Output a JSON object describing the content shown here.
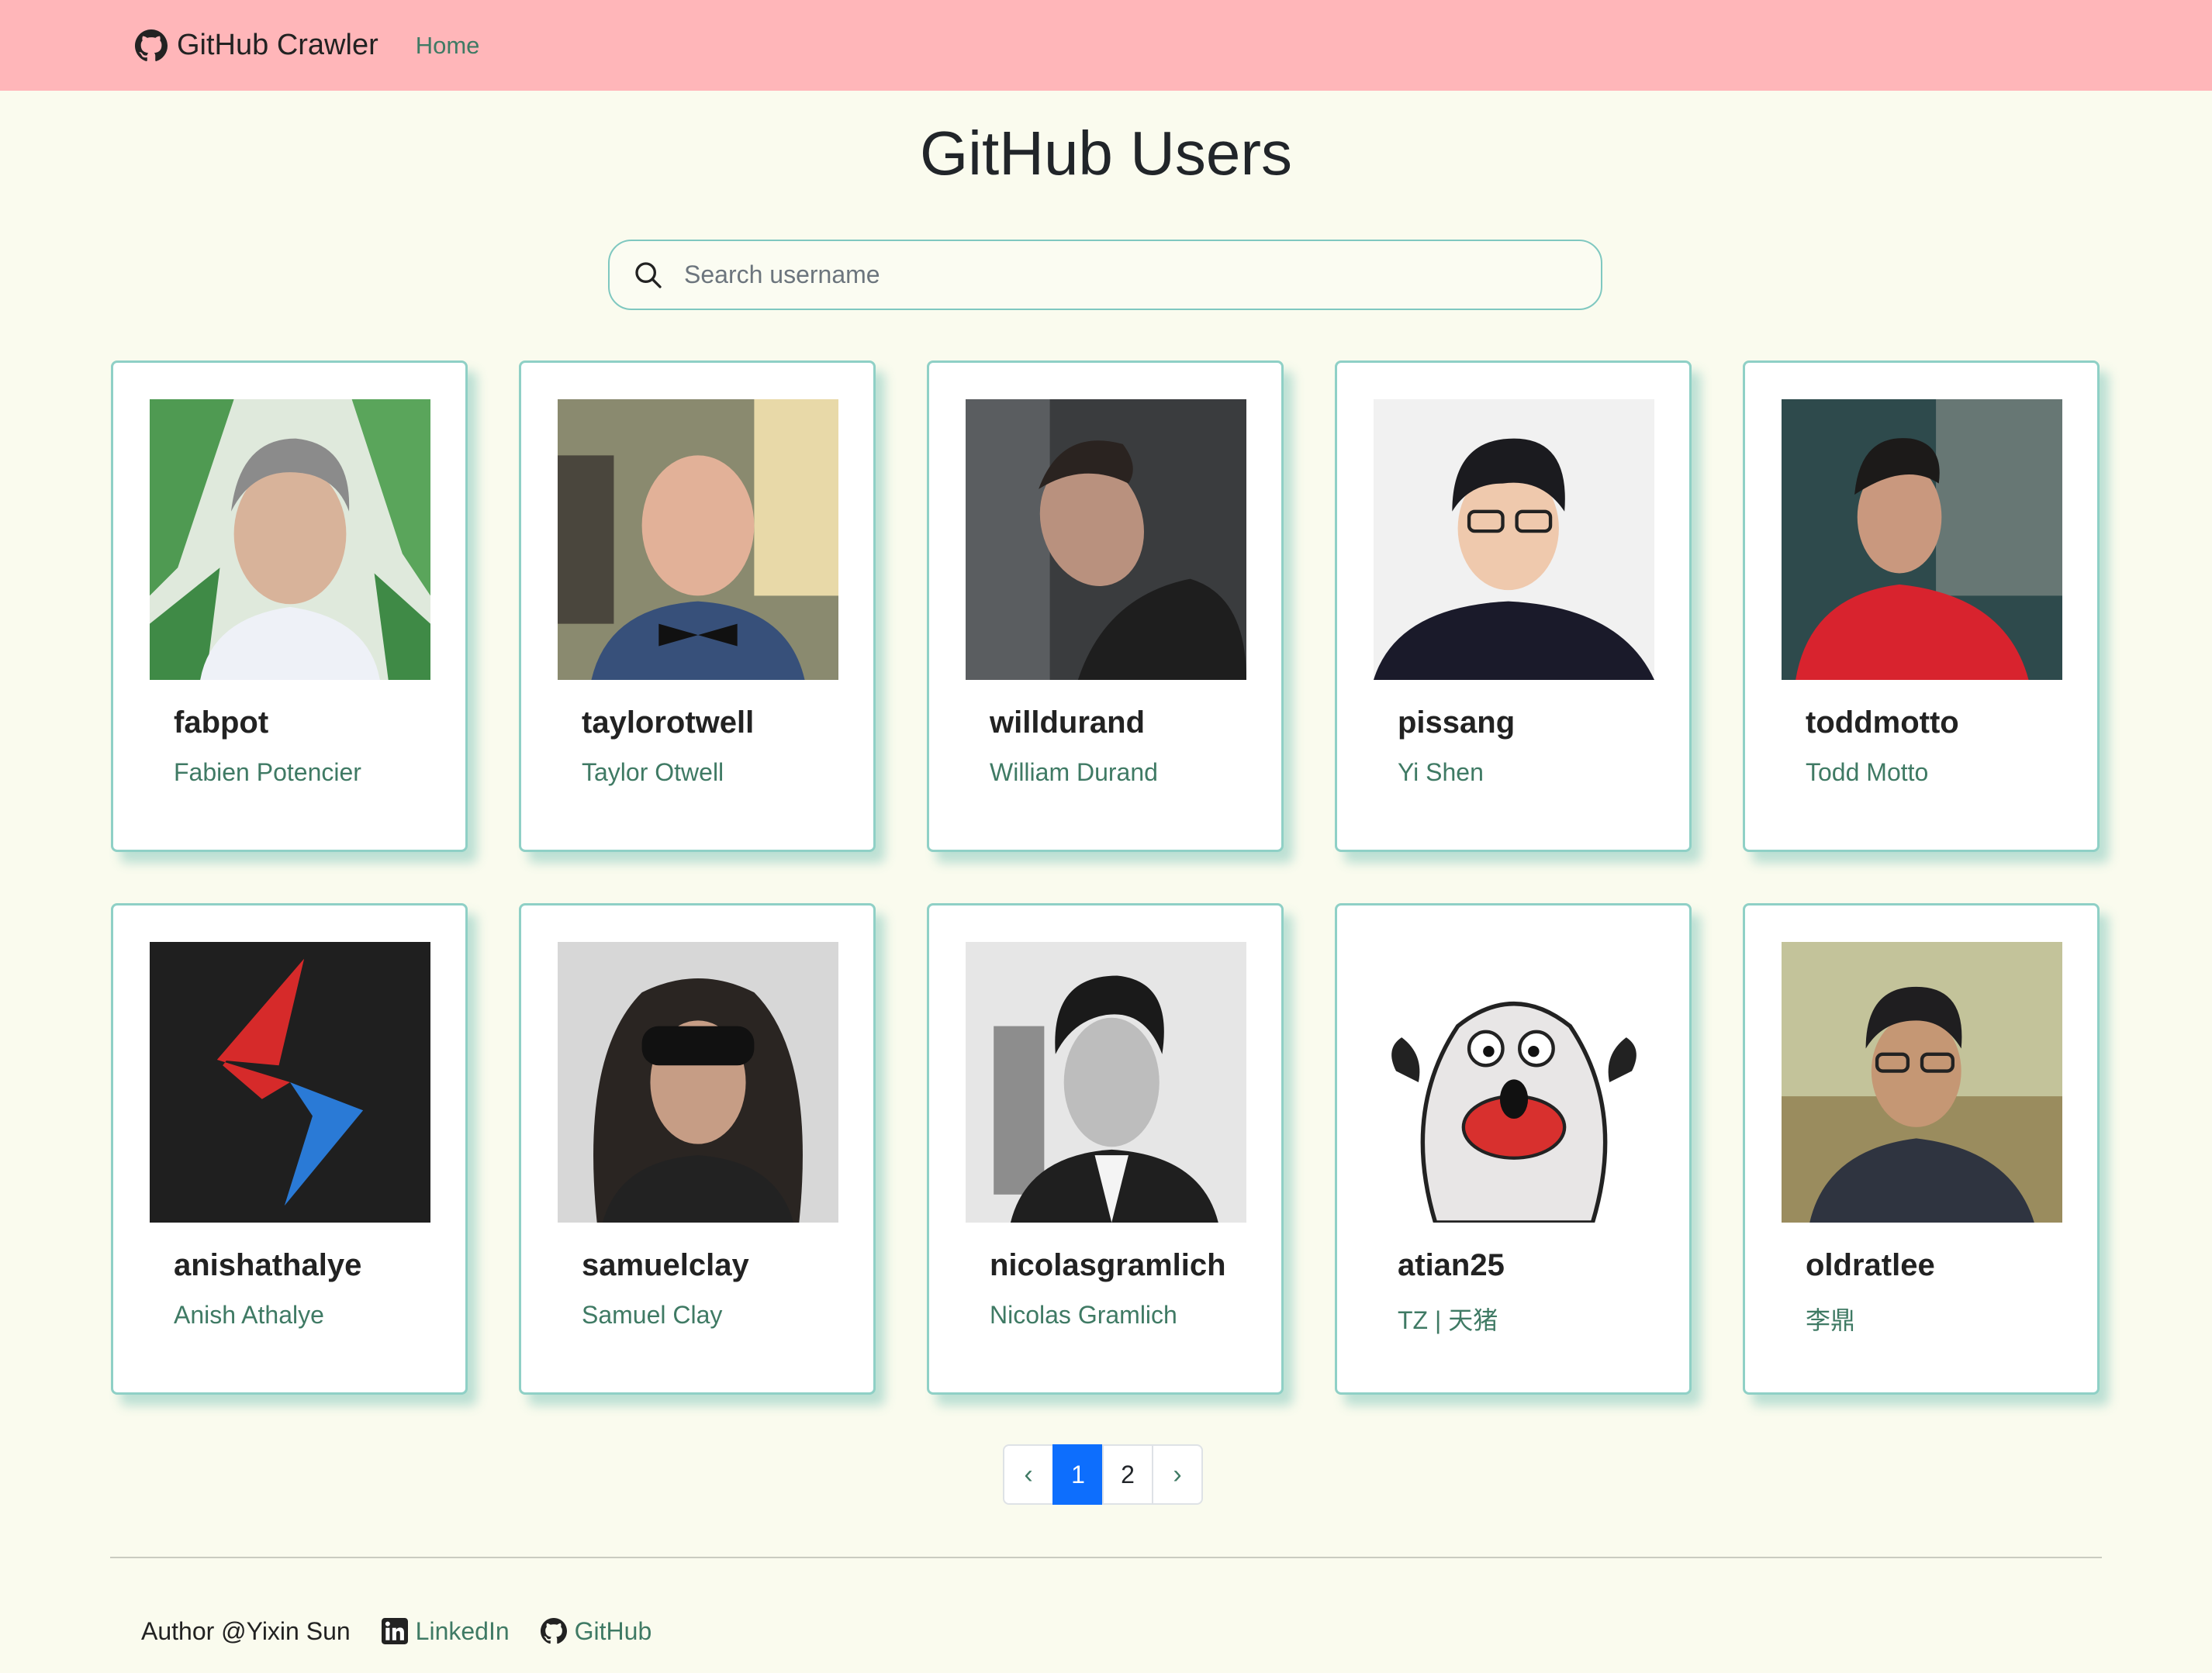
{
  "navbar": {
    "brand": "GitHub Crawler",
    "brand_icon": "github-icon",
    "home_link": "Home",
    "background": "#ffb6b9"
  },
  "title": "GitHub Users",
  "search": {
    "placeholder": "Search username",
    "value": "",
    "icon": "search-icon"
  },
  "users": [
    {
      "login": "fabpot",
      "name": "Fabien Potencier"
    },
    {
      "login": "taylorotwell",
      "name": "Taylor Otwell"
    },
    {
      "login": "willdurand",
      "name": "William Durand"
    },
    {
      "login": "pissang",
      "name": "Yi Shen"
    },
    {
      "login": "toddmotto",
      "name": "Todd Motto"
    },
    {
      "login": "anishathalye",
      "name": "Anish Athalye"
    },
    {
      "login": "samuelclay",
      "name": "Samuel Clay"
    },
    {
      "login": "nicolasgramlich",
      "name": "Nicolas Gramlich"
    },
    {
      "login": "atian25",
      "name": "TZ | 天猪"
    },
    {
      "login": "oldratlee",
      "name": "李鼎"
    }
  ],
  "pagination": {
    "prev": "‹",
    "pages": [
      "1",
      "2"
    ],
    "current": "1",
    "next": "›"
  },
  "footer": {
    "author": "Author @Yixin Sun",
    "linkedin": "LinkedIn",
    "github": "GitHub"
  },
  "colors": {
    "accent": "#3f7a64",
    "card_border": "#8fd0c6",
    "page_background": "#fafbee",
    "active_page": "#0d6efd"
  }
}
